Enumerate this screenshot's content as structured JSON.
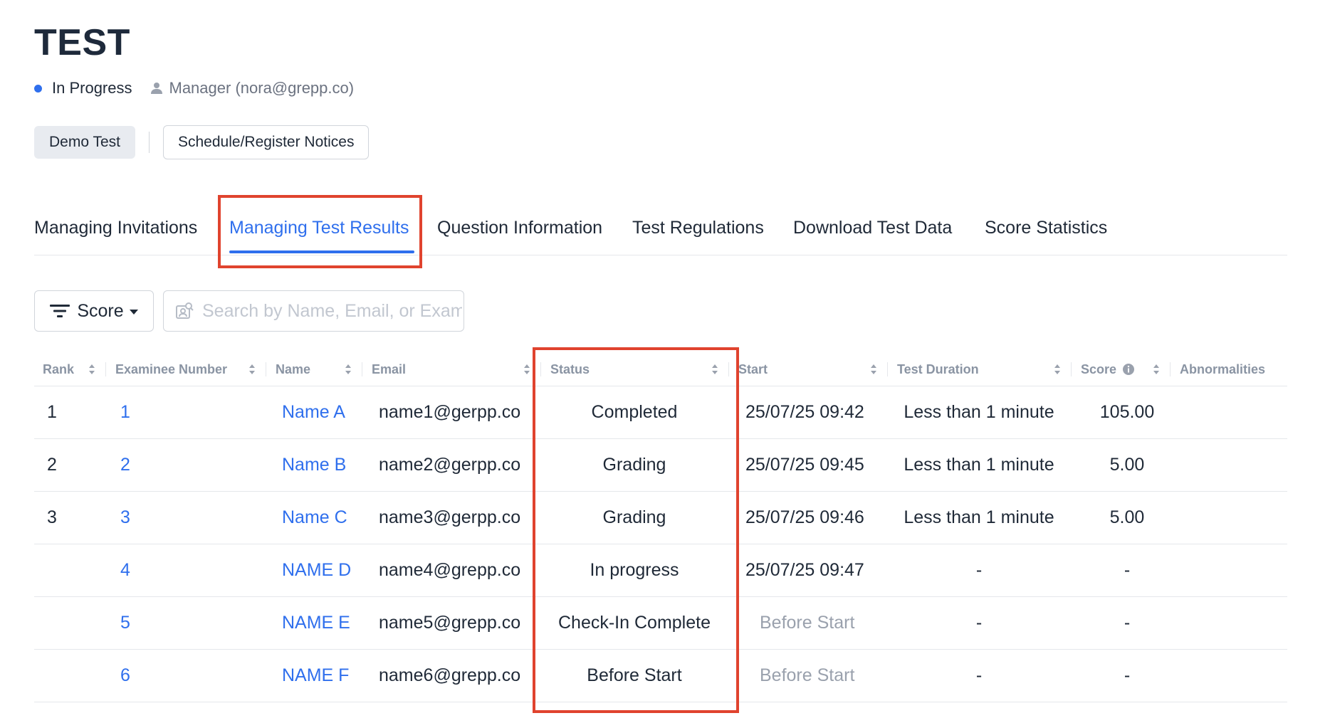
{
  "header": {
    "title": "TEST",
    "status": "In Progress",
    "status_color": "#2f6fed",
    "manager": "Manager (nora@grepp.co)"
  },
  "buttons": {
    "demo": "Demo Test",
    "notices": "Schedule/Register Notices"
  },
  "tabs": [
    {
      "label": "Managing Invitations",
      "active": false
    },
    {
      "label": "Managing Test Results",
      "active": true
    },
    {
      "label": "Question Information",
      "active": false
    },
    {
      "label": "Test Regulations",
      "active": false
    },
    {
      "label": "Download Test Data",
      "active": false
    },
    {
      "label": "Score Statistics",
      "active": false
    }
  ],
  "toolbar": {
    "filter_label": "Score",
    "search_placeholder": "Search by Name, Email, or Examinee Number"
  },
  "table": {
    "columns": [
      "Rank",
      "Examinee Number",
      "Name",
      "Email",
      "Status",
      "Start",
      "Test Duration",
      "Score",
      "Abnormalities"
    ],
    "rows": [
      {
        "rank": "1",
        "number": "1",
        "name": "Name A",
        "email": "name1@gerpp.co",
        "status": "Completed",
        "start": "25/07/25 09:42",
        "duration": "Less than 1 minute",
        "score": "105.00",
        "abnormalities": ""
      },
      {
        "rank": "2",
        "number": "2",
        "name": "Name B",
        "email": "name2@gerpp.co",
        "status": "Grading",
        "start": "25/07/25 09:45",
        "duration": "Less than 1 minute",
        "score": "5.00",
        "abnormalities": ""
      },
      {
        "rank": "3",
        "number": "3",
        "name": "Name C",
        "email": "name3@gerpp.co",
        "status": "Grading",
        "start": "25/07/25 09:46",
        "duration": "Less than 1 minute",
        "score": "5.00",
        "abnormalities": ""
      },
      {
        "rank": "",
        "number": "4",
        "name": "NAME D",
        "email": "name4@grepp.co",
        "status": "In progress",
        "start": "25/07/25 09:47",
        "duration": "-",
        "score": "-",
        "abnormalities": ""
      },
      {
        "rank": "",
        "number": "5",
        "name": "NAME E",
        "email": "name5@grepp.co",
        "status": "Check-In Complete",
        "start": "Before Start",
        "duration": "-",
        "score": "-",
        "abnormalities": ""
      },
      {
        "rank": "",
        "number": "6",
        "name": "NAME F",
        "email": "name6@grepp.co",
        "status": "Before Start",
        "start": "Before Start",
        "duration": "-",
        "score": "-",
        "abnormalities": ""
      }
    ]
  },
  "colors": {
    "accent": "#2f6fed",
    "highlight": "#e0432e"
  }
}
